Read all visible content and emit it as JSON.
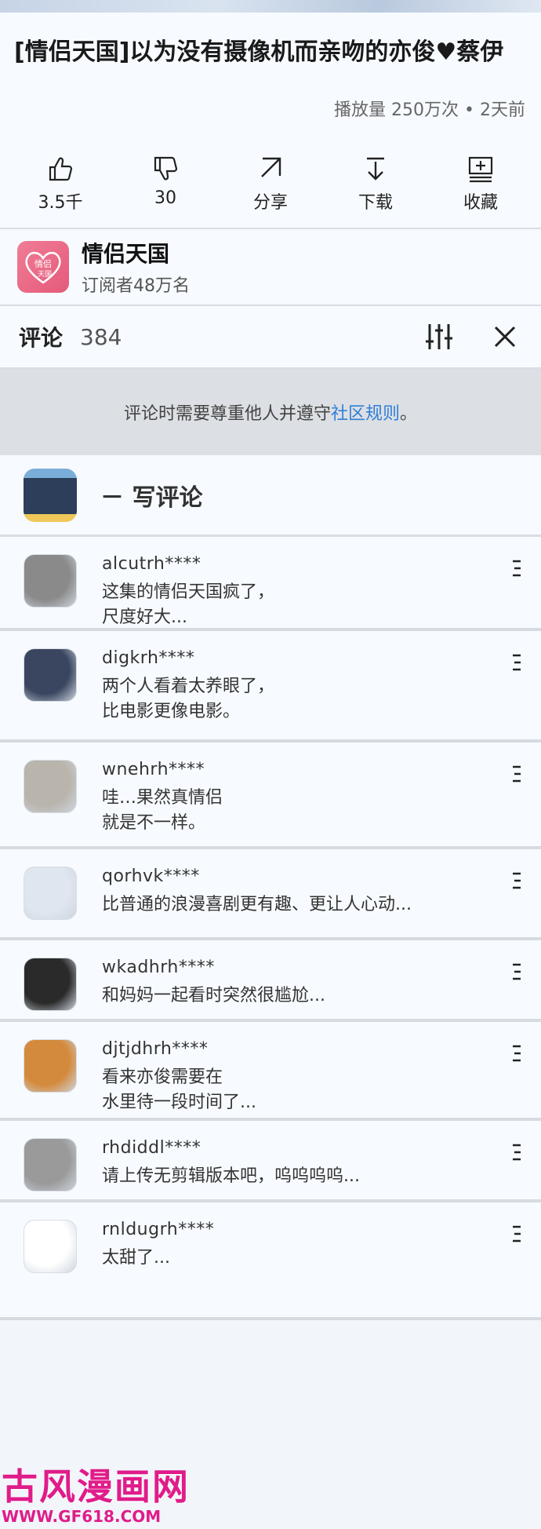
{
  "video": {
    "title": "[情侣天国]以为没有摄像机而亲吻的亦俊♥蔡伊",
    "views": "播放量 250万次 • 2天前"
  },
  "actions": [
    {
      "label": "3.5千",
      "icon": "thumbs-up-icon"
    },
    {
      "label": "30",
      "icon": "thumbs-down-icon"
    },
    {
      "label": "分享",
      "icon": "share-icon"
    },
    {
      "label": "下载",
      "icon": "download-icon"
    },
    {
      "label": "收藏",
      "icon": "save-playlist-icon"
    }
  ],
  "channel": {
    "name": "情侣天国",
    "subscribers": "订阅者48万名",
    "logo_text": "情侣",
    "logo_sub": "天国"
  },
  "comments_header": {
    "title": "评论",
    "count": "384"
  },
  "notice": {
    "text": "评论时需要尊重他人并遵守",
    "link": "社区规则",
    "tail": "。"
  },
  "write_comment": {
    "label": "－ 写评论"
  },
  "comments": [
    {
      "user": "alcutrh****",
      "text": [
        "这集的情侣天国疯了，",
        "尺度好大..."
      ],
      "avatar_color": "#8a8a8a"
    },
    {
      "user": "digkrh****",
      "text": [
        "两个人看着太养眼了，",
        "比电影更像电影。"
      ],
      "avatar_color": "#3a4660"
    },
    {
      "user": "wnehrh****",
      "text": [
        "哇…果然真情侣",
        "就是不一样。"
      ],
      "avatar_color": "#b9b4ac"
    },
    {
      "user": "qorhvk****",
      "text": [
        "比普通的浪漫喜剧更有趣、更让人心动..."
      ],
      "avatar_color": "#dfe6ef"
    },
    {
      "user": "wkadhrh****",
      "text": [
        "和妈妈一起看时突然很尴尬..."
      ],
      "avatar_color": "#2a2a2a"
    },
    {
      "user": "djtjdhrh****",
      "text": [
        "看来亦俊需要在",
        "水里待一段时间了..."
      ],
      "avatar_color": "#d48a3c"
    },
    {
      "user": "rhdiddl****",
      "text": [
        "请上传无剪辑版本吧，呜呜呜呜..."
      ],
      "avatar_color": "#9a9a9a"
    },
    {
      "user": "rnldugrh****",
      "text": [
        "太甜了..."
      ],
      "avatar_color": "#ffffff"
    }
  ],
  "watermark": {
    "title": "古风漫画网",
    "url": "WWW.GF618.COM"
  },
  "colors": {
    "link": "#2f7fd9",
    "watermark": "#e01c8a",
    "channel_logo": "#ec6a88"
  }
}
